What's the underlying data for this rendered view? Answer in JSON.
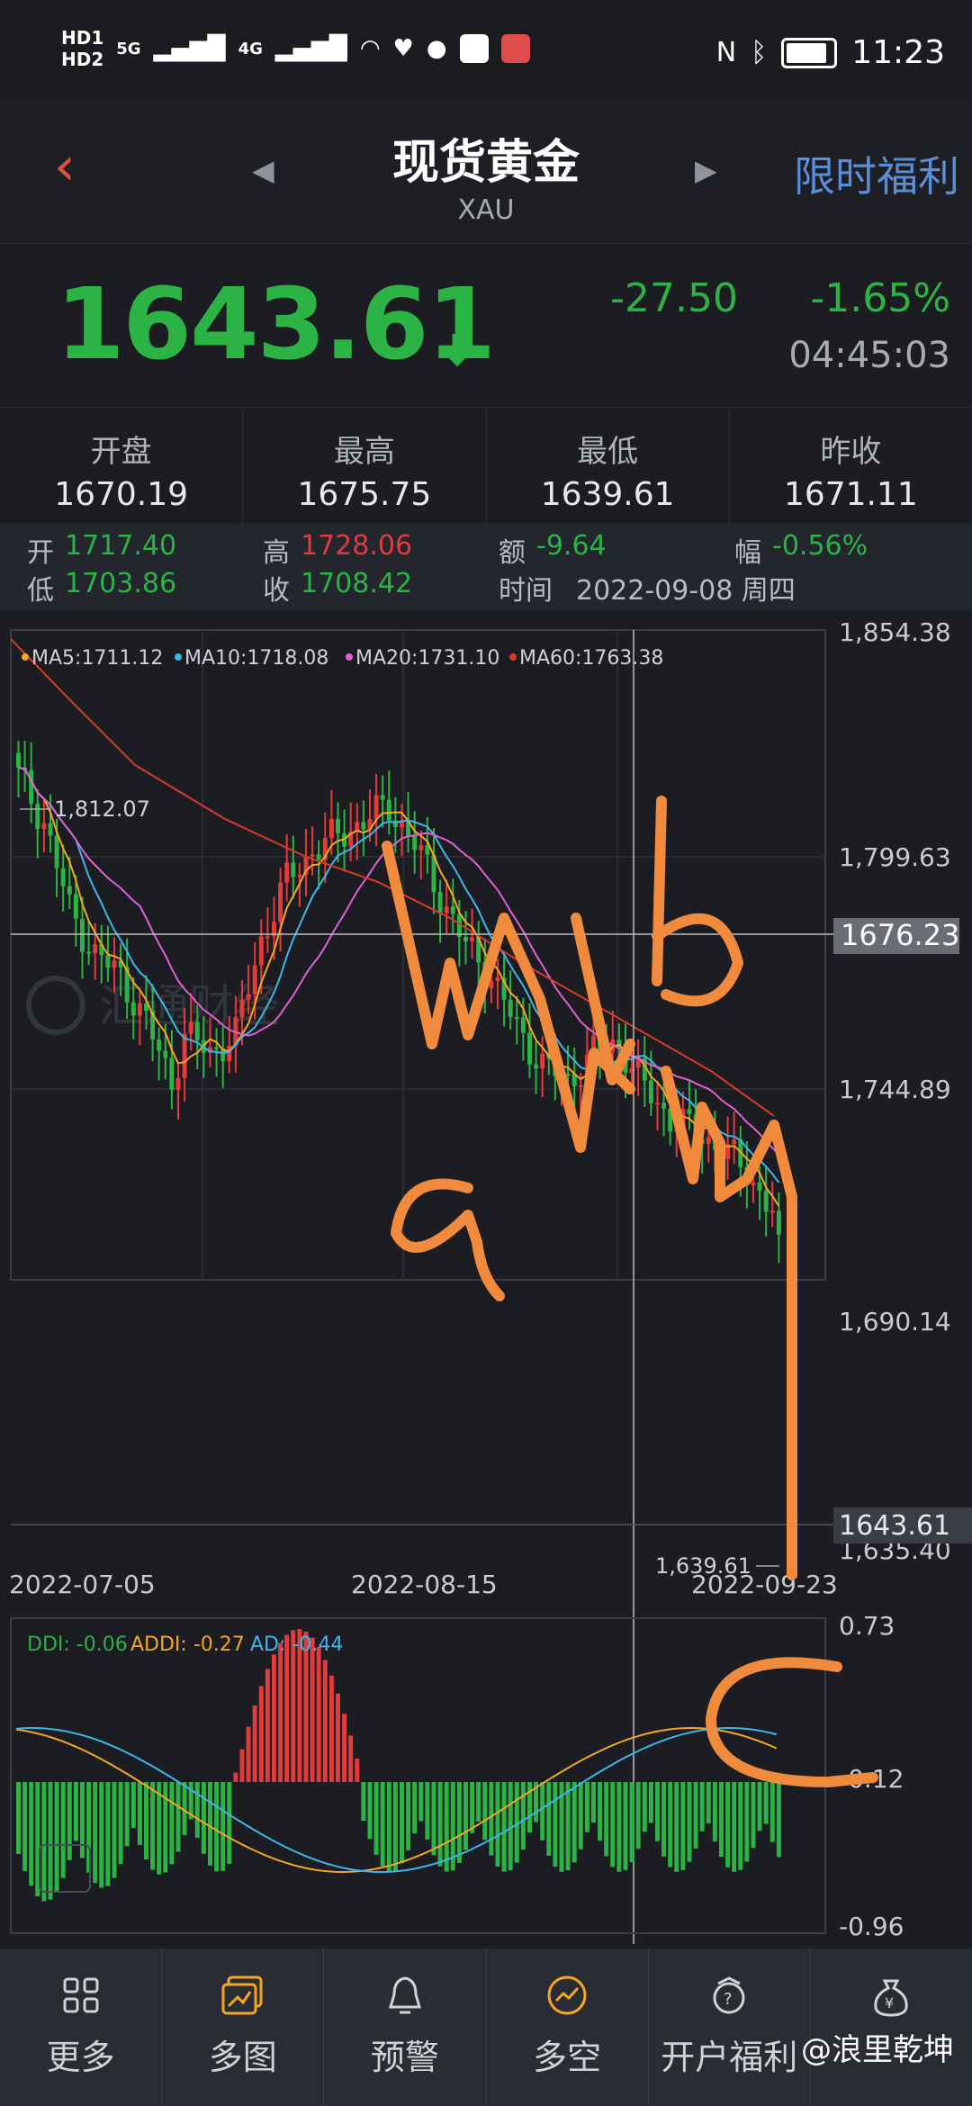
{
  "status_bar": {
    "left_badges": [
      "HD1",
      "HD2"
    ],
    "network": [
      "5G",
      "4G"
    ],
    "time": "11:23"
  },
  "header": {
    "back_icon": "chevron-left-icon",
    "title": "现货黄金",
    "subtitle": "XAU",
    "promo": "限时福利"
  },
  "price": {
    "last": "1643.61",
    "change": "-27.50",
    "change_pct": "-1.65%",
    "time": "04:45:03",
    "color": "#2cb345"
  },
  "stats": [
    {
      "label": "开盘",
      "value": "1670.19"
    },
    {
      "label": "最高",
      "value": "1675.75"
    },
    {
      "label": "最低",
      "value": "1639.61"
    },
    {
      "label": "昨收",
      "value": "1671.11"
    }
  ],
  "candle_info": {
    "open_label": "开",
    "open": "1717.40",
    "high_label": "高",
    "high": "1728.06",
    "amount_label": "额",
    "amount": "-9.64",
    "range_label": "幅",
    "range": "-0.56%",
    "low_label": "低",
    "low": "1703.86",
    "close_label": "收",
    "close": "1708.42",
    "time_label": "时间",
    "time": "2022-09-08 周四"
  },
  "chart": {
    "ma_legend": [
      {
        "label": "MA5:1711.12",
        "color": "#f5a623"
      },
      {
        "label": "MA10:1718.08",
        "color": "#3fb6ea"
      },
      {
        "label": "MA20:1731.10",
        "color": "#e060d0"
      },
      {
        "label": "MA60:1763.38",
        "color": "#d83a2a"
      }
    ],
    "y_ticks": [
      "1,854.38",
      "1,799.63",
      "1,744.89",
      "1,690.14",
      "1,635.40"
    ],
    "crosshair_price": "1676.23",
    "last_price_tag": "1643.61",
    "high_marker": "1,812.07",
    "low_marker": "1,639.61",
    "x_ticks": [
      "2022-07-05",
      "2022-08-15",
      "2022-09-23"
    ],
    "watermark": "汇通财经",
    "annotations": [
      "a",
      "b",
      "c"
    ]
  },
  "indicator": {
    "legend": [
      {
        "label": "DDI: -0.06",
        "color": "#2cb345"
      },
      {
        "label": "ADDI: -0.27",
        "color": "#f5a623"
      },
      {
        "label": "AD: -0.44",
        "color": "#3fb6ea"
      }
    ],
    "y_ticks": [
      "0.73",
      "-0.12",
      "-0.96"
    ]
  },
  "nav": [
    {
      "label": "更多",
      "icon": "grid-icon"
    },
    {
      "label": "多图",
      "icon": "multi-chart-icon"
    },
    {
      "label": "预警",
      "icon": "bell-icon"
    },
    {
      "label": "多空",
      "icon": "trend-icon"
    },
    {
      "label": "开户福利",
      "icon": "gift-icon"
    },
    {
      "label": "",
      "icon": "money-bag-icon"
    }
  ],
  "user_watermark": "@浪里乾坤"
}
